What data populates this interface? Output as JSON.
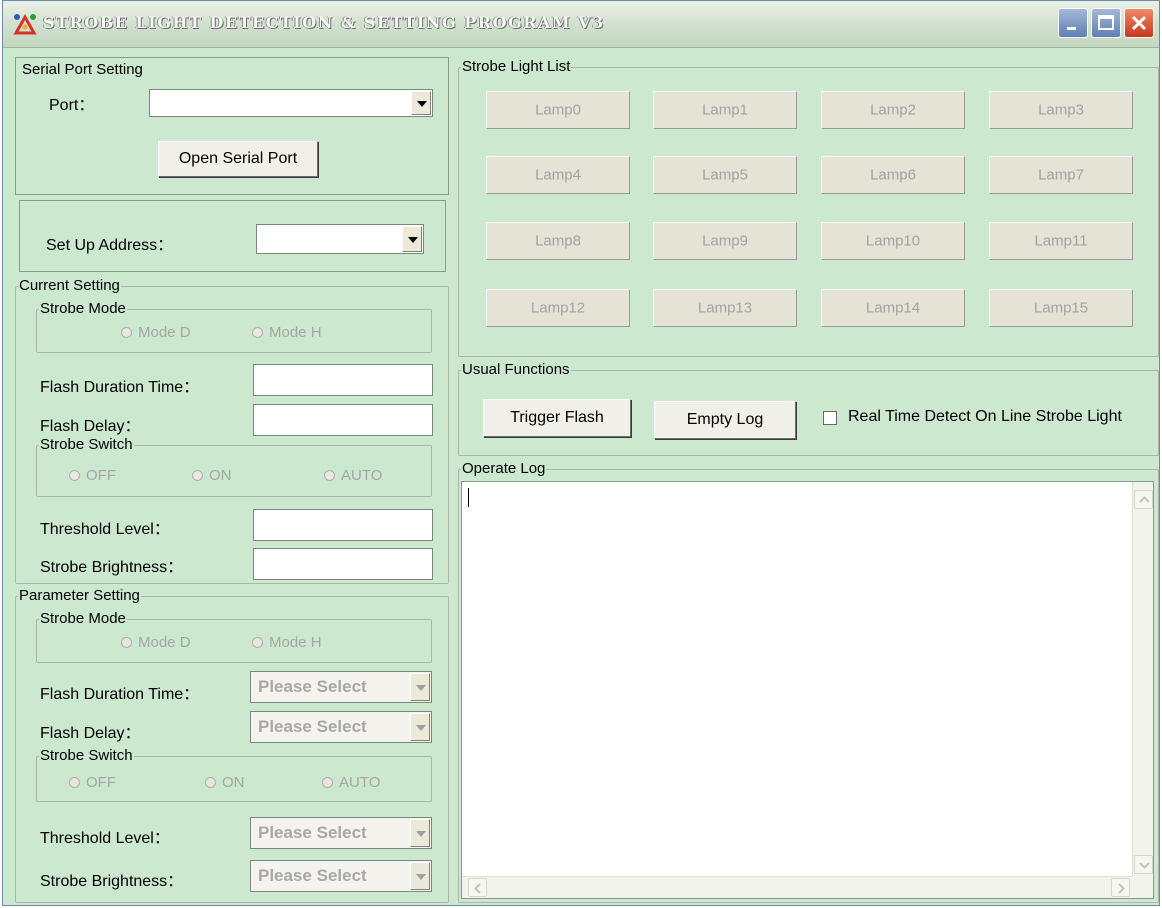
{
  "window": {
    "title": "STROBE LIGHT DETECTION & SETTING PROGRAM V3"
  },
  "serial": {
    "legend": "Serial Port Setting",
    "port_label": "Port：",
    "port_value": "",
    "open_button": "Open Serial Port"
  },
  "address": {
    "label": "Set Up Address：",
    "value": ""
  },
  "current": {
    "legend": "Current Setting",
    "strobe_mode_legend": "Strobe Mode",
    "mode_d": "Mode D",
    "mode_h": "Mode H",
    "flash_duration_label": "Flash Duration Time：",
    "flash_delay_label": "Flash Delay：",
    "strobe_switch_legend": "Strobe Switch",
    "off": "OFF",
    "on": "ON",
    "auto": "AUTO",
    "threshold_label": "Threshold Level：",
    "brightness_label": "Strobe Brightness："
  },
  "parameter": {
    "legend": "Parameter Setting",
    "strobe_mode_legend": "Strobe Mode",
    "mode_d": "Mode D",
    "mode_h": "Mode H",
    "flash_duration_label": "Flash Duration Time：",
    "flash_delay_label": "Flash Delay：",
    "strobe_switch_legend": "Strobe Switch",
    "off": "OFF",
    "on": "ON",
    "auto": "AUTO",
    "threshold_label": "Threshold Level：",
    "brightness_label": "Strobe Brightness：",
    "placeholder": "Please Select"
  },
  "lamps": {
    "legend": "Strobe Light List",
    "items": [
      "Lamp0",
      "Lamp1",
      "Lamp2",
      "Lamp3",
      "Lamp4",
      "Lamp5",
      "Lamp6",
      "Lamp7",
      "Lamp8",
      "Lamp9",
      "Lamp10",
      "Lamp11",
      "Lamp12",
      "Lamp13",
      "Lamp14",
      "Lamp15"
    ]
  },
  "functions": {
    "legend": "Usual Functions",
    "trigger_button": "Trigger Flash",
    "empty_button": "Empty Log",
    "realtime_label": "Real Time Detect On Line Strobe Light"
  },
  "log": {
    "legend": "Operate Log",
    "content": ""
  },
  "colors": {
    "window_bg": "#cce8cf",
    "close_red": "#c8371e",
    "title_blue": "#5f7fb5"
  }
}
